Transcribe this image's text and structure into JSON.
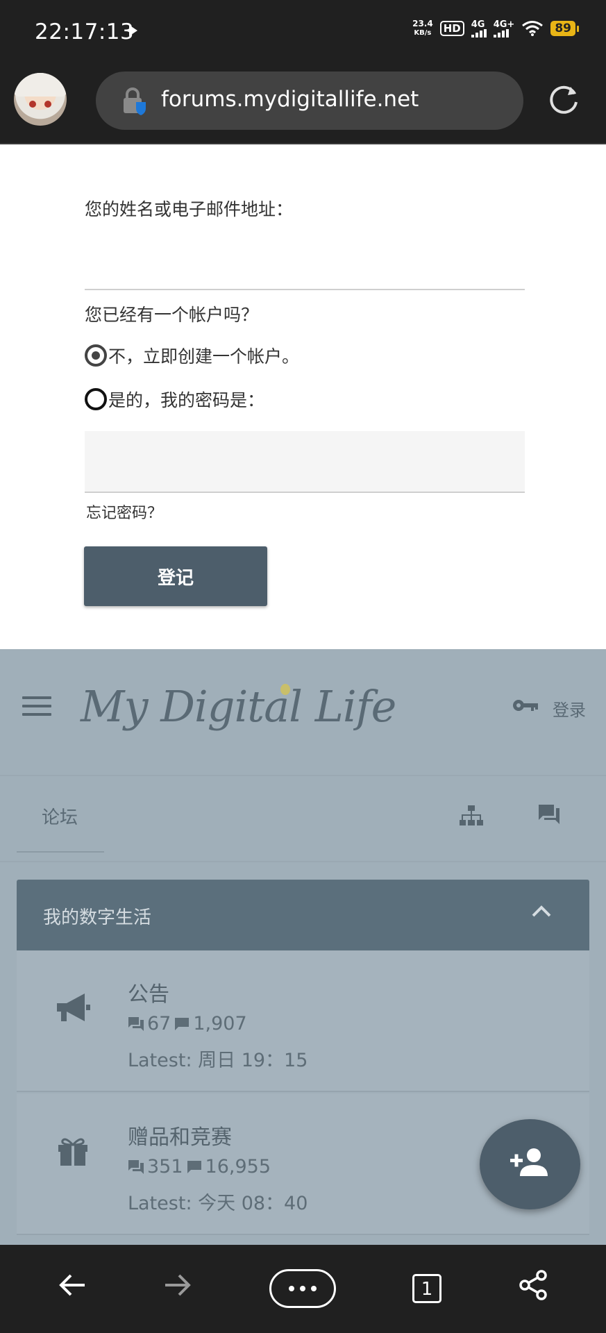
{
  "status_bar": {
    "time": "22:17:13",
    "speed_value": "23.4",
    "speed_unit": "KB/s",
    "hd": "HD",
    "sim1": "4G",
    "sim2": "4G+",
    "battery": "89"
  },
  "browser": {
    "url": "forums.mydigitallife.net",
    "tab_count": "1"
  },
  "login_form": {
    "name_label": "您的姓名或电子邮件地址：",
    "name_value": "",
    "account_question": "您已经有一个帐户吗？",
    "option_new": "不，立即创建一个帐户。",
    "option_new_checked": true,
    "option_existing": "是的，我的密码是：",
    "option_existing_checked": false,
    "password_value": "",
    "forgot_password": "忘记密码？",
    "submit_label": "登记"
  },
  "site": {
    "logo_text": "My Digital Life",
    "login_label": "登录",
    "tab_forum": "论坛",
    "category_title": "我的数字生活",
    "forums": [
      {
        "title": "公告",
        "threads": "67",
        "messages": "1,907",
        "latest": "Latest: 周日 19：15",
        "icon": "megaphone-icon"
      },
      {
        "title": "赠品和竞赛",
        "threads": "351",
        "messages": "16,955",
        "latest": "Latest: 今天 08：40",
        "icon": "gift-icon"
      }
    ]
  },
  "colors": {
    "dark_bar": "#202020",
    "button": "#4d5e6b",
    "overlay": "#a0afb9",
    "category_header": "#5b6f7c"
  }
}
